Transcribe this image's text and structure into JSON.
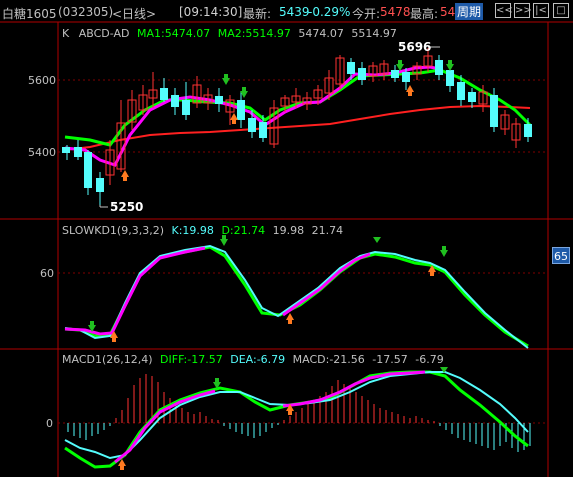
{
  "header": {
    "name": "白糖1605",
    "code": "(032305)",
    "period_tag": "<日线>",
    "time": "[09:14:30]",
    "latest_label": "最新:",
    "latest_value": "5439",
    "change_pct": "-0.29%",
    "open_label": "今开:",
    "open_value": "5478",
    "high_label": "最高:",
    "high_value": "54",
    "period_button": "周期",
    "nav_buttons": [
      "<<",
      ">>",
      "|<",
      "□"
    ]
  },
  "main_panel": {
    "k_label": "K",
    "indicator": "ABCD-AD",
    "ma1": "MA1:5474.07",
    "ma2": "MA2:5514.97",
    "v1": "5474.07",
    "v2": "5514.97",
    "y_ticks": [
      "5600",
      "5400"
    ],
    "annotations": {
      "high": "5696",
      "low": "5250"
    }
  },
  "kd_panel": {
    "title": "SLOWKD1(9,3,3,2)",
    "k": "K:19.98",
    "d": "D:21.74",
    "v1": "19.98",
    "v2": "21.74",
    "y_tick": "60",
    "scale_badge": "65"
  },
  "macd_panel": {
    "title": "MACD1(26,12,4)",
    "diff": "DIFF:-17.57",
    "dea": "DEA:-6.79",
    "macd": "MACD:-21.56",
    "v1": "-17.57",
    "v2": "-6.79",
    "y_tick": "0"
  },
  "colors": {
    "up": "#ff3232",
    "down": "#54fcfc",
    "ma_fast": "#ff00ff",
    "ma_slow": "#00ff00",
    "ma_long": "#ff2020",
    "grid": "#b00000",
    "badge": "#1e5aa8"
  },
  "icons": [
    "arrow-up-icon",
    "arrow-down-icon"
  ]
}
